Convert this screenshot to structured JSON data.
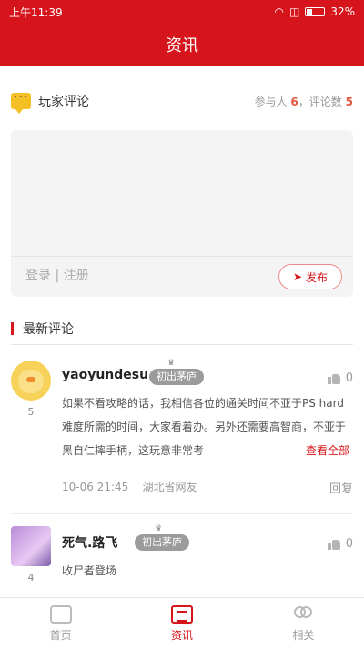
{
  "status_bar": {
    "time": "上午11:39",
    "battery": "32%"
  },
  "header": {
    "title": "资讯"
  },
  "player_comments": {
    "title": "玩家评论",
    "participants_label": "参与人",
    "participants": "6",
    "sep": "，",
    "comments_label": "评论数",
    "comments": "5"
  },
  "composer": {
    "login_text": "登录 | 注册",
    "publish_label": "发布"
  },
  "latest": {
    "title": "最新评论"
  },
  "comments": [
    {
      "username": "yaoyundesu",
      "level": "5",
      "badge": "初出茅庐",
      "likes": "0",
      "content": "如果不看攻略的话，我相信各位的通关时间不亚于PS hard难度所需的时间，大家看着办。另外还需要高智商，不亚于黑自仁摔手柄，这玩意非常考",
      "view_all": "查看全部",
      "time": "10-06 21:45",
      "location": "湖北省网友",
      "reply": "回复"
    },
    {
      "username": "死气.路飞",
      "level": "4",
      "badge": "初出茅庐",
      "likes": "0",
      "content": "收尸者登场"
    }
  ],
  "tabbar": {
    "tabs": [
      "首页",
      "资讯",
      "相关"
    ]
  }
}
